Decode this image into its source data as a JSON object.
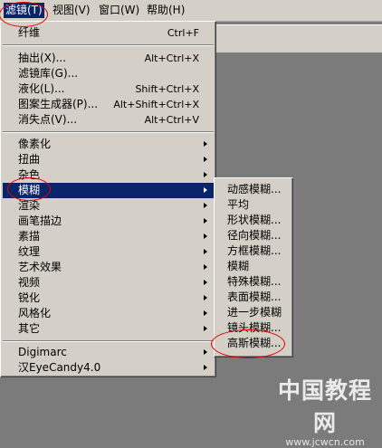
{
  "menubar": {
    "items": [
      {
        "label": "滤镜(T)"
      },
      {
        "label": "视图(V)"
      },
      {
        "label": "窗口(W)"
      },
      {
        "label": "帮助(H)"
      }
    ]
  },
  "filter_menu": {
    "items": [
      {
        "label": "纤维",
        "shortcut": "Ctrl+F"
      },
      {
        "label": "抽出(X)...",
        "shortcut": "Alt+Ctrl+X"
      },
      {
        "label": "滤镜库(G)..."
      },
      {
        "label": "液化(L)...",
        "shortcut": "Shift+Ctrl+X"
      },
      {
        "label": "图案生成器(P)...",
        "shortcut": "Alt+Shift+Ctrl+X"
      },
      {
        "label": "消失点(V)...",
        "shortcut": "Alt+Ctrl+V"
      },
      {
        "label": "像素化"
      },
      {
        "label": "扭曲"
      },
      {
        "label": "杂色"
      },
      {
        "label": "模糊"
      },
      {
        "label": "渲染"
      },
      {
        "label": "画笔描边"
      },
      {
        "label": "素描"
      },
      {
        "label": "纹理"
      },
      {
        "label": "艺术效果"
      },
      {
        "label": "视频"
      },
      {
        "label": "锐化"
      },
      {
        "label": "风格化"
      },
      {
        "label": "其它"
      },
      {
        "label": "Digimarc"
      },
      {
        "label": "汉EyeCandy4.0"
      }
    ]
  },
  "blur_submenu": {
    "items": [
      {
        "label": "动感模糊..."
      },
      {
        "label": "平均"
      },
      {
        "label": "形状模糊..."
      },
      {
        "label": "径向模糊..."
      },
      {
        "label": "方框模糊..."
      },
      {
        "label": "模糊"
      },
      {
        "label": "特殊模糊..."
      },
      {
        "label": "表面模糊..."
      },
      {
        "label": "进一步模糊"
      },
      {
        "label": "镜头模糊..."
      },
      {
        "label": "高斯模糊..."
      }
    ]
  },
  "watermark": {
    "main": "中国教程网",
    "sub": "www.jcwcn.com"
  },
  "colors": {
    "highlight": "#0a246a",
    "menu_bg": "#d4d0c8",
    "annotation": "#e00000"
  }
}
